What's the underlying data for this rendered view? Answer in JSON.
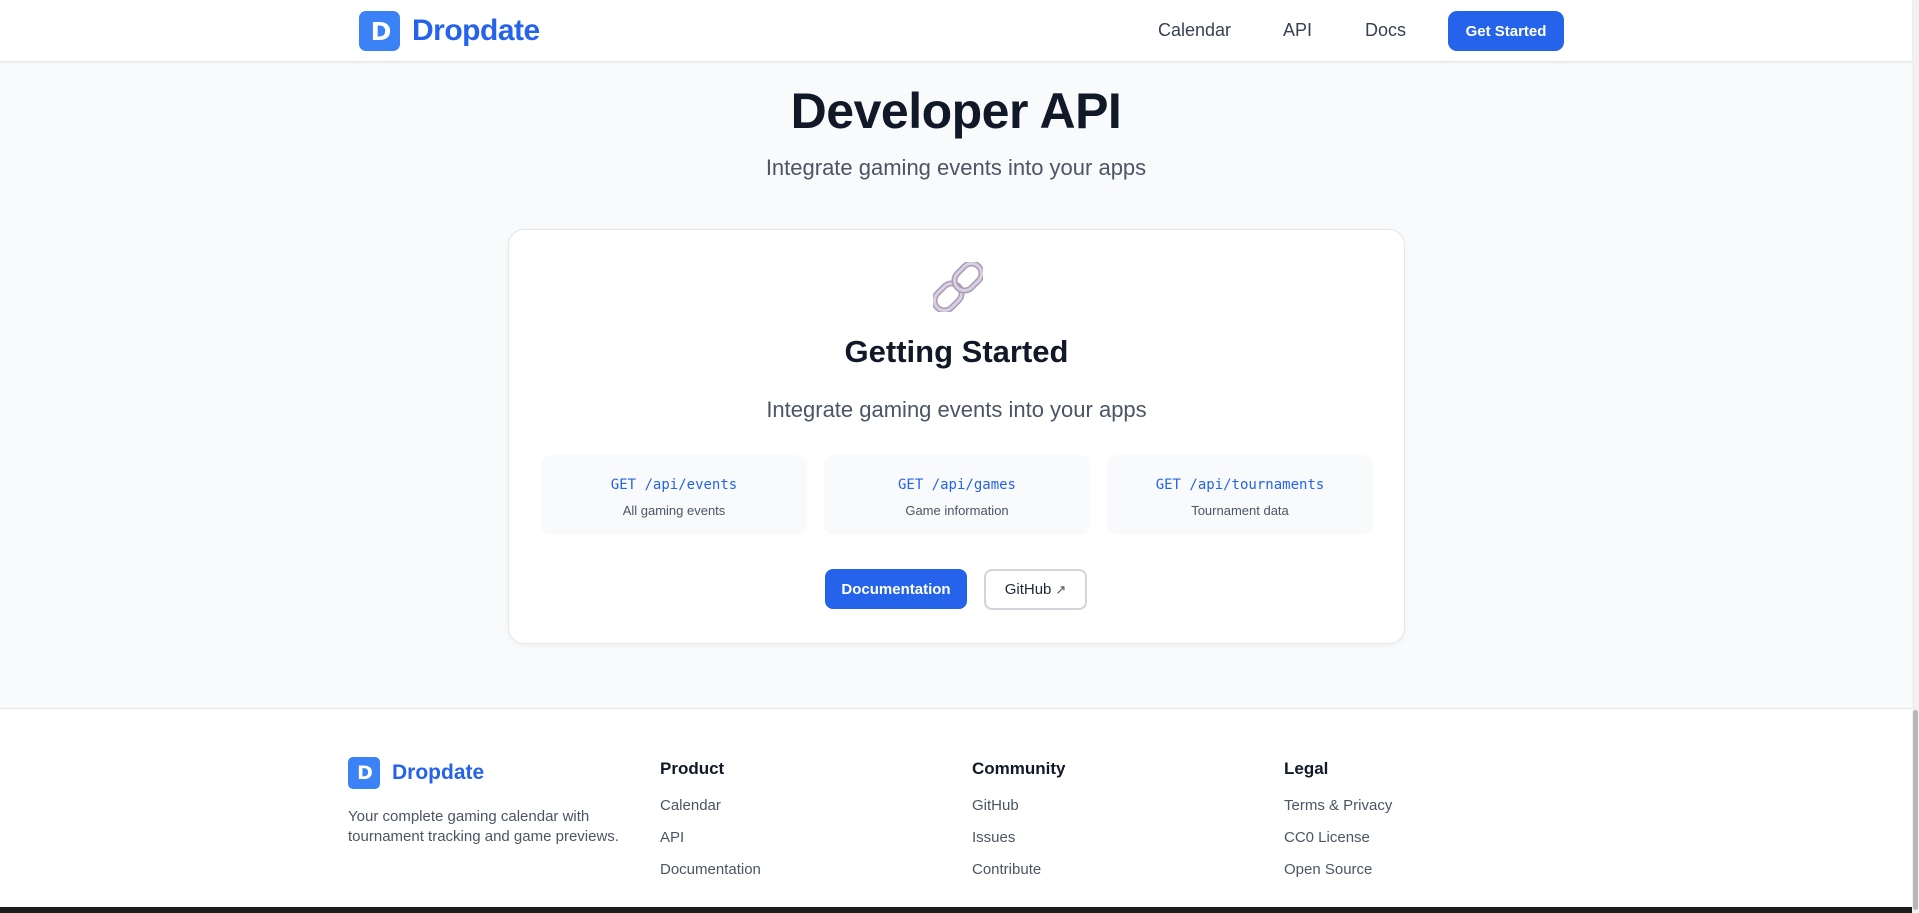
{
  "header": {
    "logo_text": "Dropdate",
    "nav": [
      "Calendar",
      "API",
      "Docs"
    ],
    "cta_label": "Get Started"
  },
  "hero": {
    "title": "Developer API",
    "subtitle": "Integrate gaming events into your apps"
  },
  "card": {
    "icon": "link-icon",
    "title": "Getting Started",
    "subtitle": "Integrate gaming events into your apps",
    "endpoints": [
      {
        "path": "GET /api/events",
        "desc": "All gaming events"
      },
      {
        "path": "GET /api/games",
        "desc": "Game information"
      },
      {
        "path": "GET /api/tournaments",
        "desc": "Tournament data"
      }
    ],
    "doc_button": "Documentation",
    "github_button": "GitHub",
    "github_arrow": "↗"
  },
  "footer": {
    "logo_text": "Dropdate",
    "description": "Your complete gaming calendar with tournament tracking and game previews.",
    "columns": [
      {
        "title": "Product",
        "links": [
          "Calendar",
          "API",
          "Documentation"
        ]
      },
      {
        "title": "Community",
        "links": [
          "GitHub",
          "Issues",
          "Contribute"
        ]
      },
      {
        "title": "Legal",
        "links": [
          "Terms & Privacy",
          "CC0 License",
          "Open Source"
        ]
      }
    ]
  },
  "colors": {
    "brand": "#2563eb",
    "brand_light": "#3b82f6",
    "background": "#f8fafc"
  }
}
